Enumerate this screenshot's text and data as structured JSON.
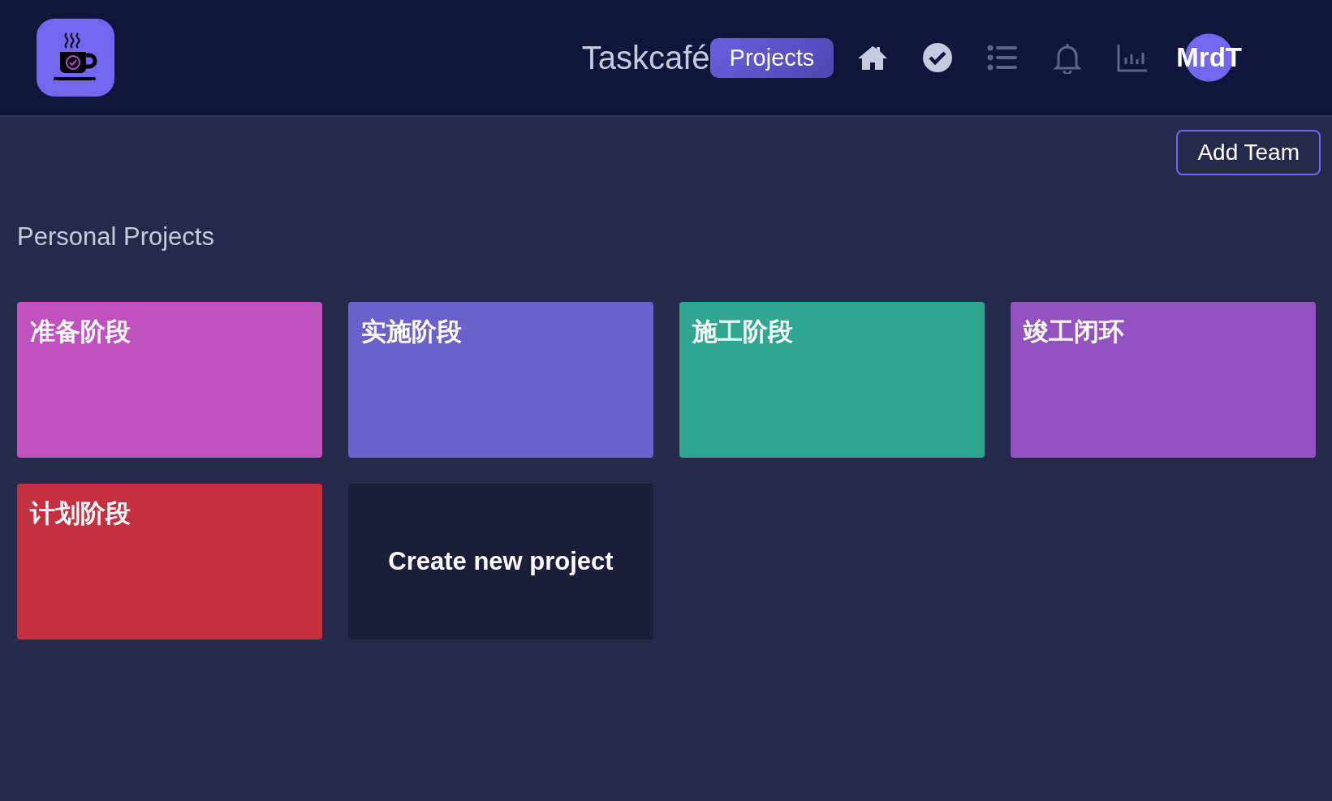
{
  "header": {
    "app_name": "Taskcafé",
    "projects_button": "Projects",
    "nav_icons": [
      {
        "kind": "home",
        "bright": true
      },
      {
        "kind": "check",
        "bright": true
      },
      {
        "kind": "list",
        "bright": false
      },
      {
        "kind": "bell",
        "bright": false
      },
      {
        "kind": "chart",
        "bright": false
      }
    ],
    "avatar": "MrdT"
  },
  "add_team_button": "Add Team",
  "section_title": "Personal Projects",
  "projects": [
    {
      "name": "准备阶段",
      "color": "#c052c0"
    },
    {
      "name": "实施阶段",
      "color": "#6a61cb"
    },
    {
      "name": "施工阶段",
      "color": "#2fa68f"
    },
    {
      "name": "竣工闭环",
      "color": "#9253c0"
    },
    {
      "name": "计划阶段",
      "color": "#c43040"
    }
  ],
  "create_card": "Create new project"
}
